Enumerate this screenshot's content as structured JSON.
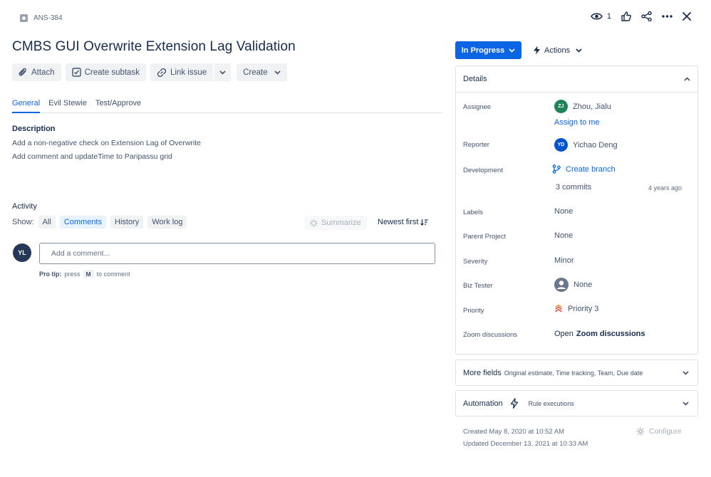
{
  "header": {
    "issue_key": "ANS-384",
    "watch_count": "1",
    "title": "CMBS GUI Overwrite Extension Lag Validation"
  },
  "toolbar": {
    "attach": "Attach",
    "create_subtask": "Create subtask",
    "link_issue": "Link issue",
    "create": "Create"
  },
  "tabs": [
    "General",
    "Evil Stewie",
    "Test/Approve"
  ],
  "description": {
    "heading": "Description",
    "lines": [
      "Add a non-negative check on Extension Lag of Overwrite",
      "Add comment and updateTime to Paripassu grid"
    ]
  },
  "activity": {
    "heading": "Activity",
    "show_label": "Show:",
    "filters": [
      "All",
      "Comments",
      "History",
      "Work log"
    ],
    "summarize": "Summarize",
    "sort": "Newest first",
    "user_initials": "YL",
    "comment_placeholder": "Add a comment...",
    "protip_bold": "Pro tip:",
    "protip_press": "press",
    "protip_key": "M",
    "protip_rest": "to comment"
  },
  "status": {
    "current": "In Progress",
    "actions": "Actions"
  },
  "details": {
    "heading": "Details",
    "fields": {
      "assignee_label": "Assignee",
      "assignee_initials": "ZJ",
      "assignee_name": "Zhou, Jialu",
      "assign_to_me": "Assign to me",
      "reporter_label": "Reporter",
      "reporter_initials": "YD",
      "reporter_name": "Yichao Deng",
      "development_label": "Development",
      "create_branch": "Create branch",
      "commits": "3 commits",
      "commits_age": "4 years ago",
      "labels_label": "Labels",
      "labels_value": "None",
      "parent_label": "Parent Project",
      "parent_value": "None",
      "severity_label": "Severity",
      "severity_value": "Minor",
      "biz_tester_label": "Biz Tester",
      "biz_tester_value": "None",
      "priority_label": "Priority",
      "priority_value": "Priority 3",
      "zoom_label": "Zoom discussions",
      "zoom_prefix": "Open",
      "zoom_link": "Zoom discussions"
    }
  },
  "more_fields": {
    "title": "More fields",
    "subtitle": "Original estimate, Time tracking, Team, Due date"
  },
  "automation": {
    "title": "Automation",
    "subtitle": "Rule executions"
  },
  "meta": {
    "created": "Created May 8, 2020 at 10:52 AM",
    "updated": "Updated December 13, 2021 at 10:33 AM",
    "configure": "Configure"
  },
  "colors": {
    "accent": "#0c66e4",
    "assignee_avatar": "#1f845a",
    "reporter_avatar": "#0055cc",
    "priority": "#e2483d"
  }
}
